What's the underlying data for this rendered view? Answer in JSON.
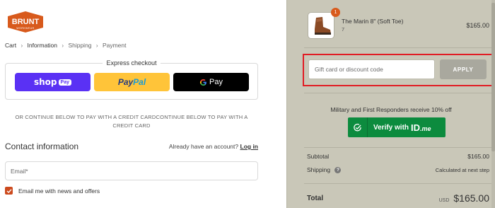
{
  "brand": {
    "name": "BRUNT",
    "sub": "WORKWEAR",
    "accent": "#d85a1c"
  },
  "breadcrumb": {
    "cart": "Cart",
    "information": "Information",
    "shipping": "Shipping",
    "payment": "Payment"
  },
  "express": {
    "title": "Express checkout",
    "shop_pay": {
      "label": "shop",
      "tag": "Pay",
      "color": "#5a31f4"
    },
    "paypal": {
      "label_a": "Pay",
      "label_b": "Pal",
      "color": "#ffc439"
    },
    "gpay": {
      "label": "Pay",
      "color": "#000000"
    }
  },
  "or_text": "OR CONTINUE BELOW TO PAY WITH A CREDIT CARDCONTINUE BELOW TO PAY WITH A CREDIT CARD",
  "contact": {
    "title": "Contact information",
    "account_prompt": "Already have an account?",
    "login_label": "Log in",
    "email_placeholder": "Email*",
    "newsletter_label": "Email me with news and offers"
  },
  "cart": {
    "item": {
      "name": "The Marin 8\" (Soft Toe)",
      "variant": "7",
      "price": "$165.00",
      "quantity": "1"
    },
    "discount": {
      "placeholder": "Gift card or discount code",
      "apply_label": "APPLY"
    },
    "military": {
      "text": "Military and First Responders receive 10% off",
      "verify_label": "Verify with",
      "brand_a": "ID",
      "brand_b": ".me"
    },
    "summary": {
      "subtotal_label": "Subtotal",
      "subtotal_value": "$165.00",
      "shipping_label": "Shipping",
      "shipping_value": "Calculated at next step",
      "total_label": "Total",
      "currency": "USD",
      "total_value": "$165.00"
    }
  }
}
